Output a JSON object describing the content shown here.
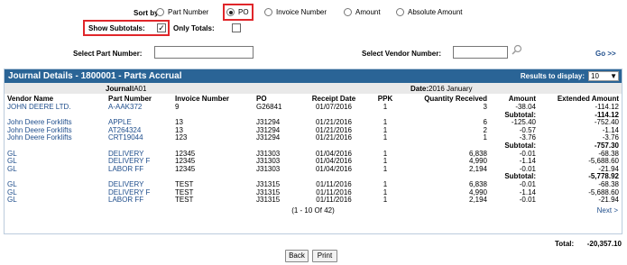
{
  "sort": {
    "label": "Sort by:",
    "options": [
      "Part Number",
      "PO",
      "Invoice Number",
      "Amount",
      "Absolute Amount"
    ],
    "selected": "PO"
  },
  "subtotals": {
    "label": "Show Subtotals:",
    "checked": true,
    "mark": "✓"
  },
  "totals": {
    "label": "Only Totals:",
    "checked": false
  },
  "part_search": {
    "label": "Select Part Number:",
    "value": ""
  },
  "vendor_search": {
    "label": "Select Vendor Number:",
    "value": "",
    "go": "Go >>"
  },
  "panel": {
    "title": "Journal Details - 1800001 - Parts Accrual",
    "results_label": "Results to display:",
    "results_value": "10",
    "journal_label": "Journal:",
    "journal_value": "IA01",
    "date_label": "Date:",
    "date_value": "2016 January"
  },
  "columns": [
    "Vendor Name",
    "Part Number",
    "Invoice Number",
    "PO",
    "Receipt Date",
    "PPK",
    "Quantity Received",
    "Amount",
    "Extended Amount"
  ],
  "rows": [
    {
      "type": "row",
      "cells": [
        "JOHN DEERE LTD.",
        "A-AAK372",
        "9",
        "G26841",
        "01/07/2016",
        "1",
        "3",
        "-38.04",
        "-114.12"
      ]
    },
    {
      "type": "subtotal",
      "label": "Subtotal:",
      "value": "-114.12"
    },
    {
      "type": "row",
      "cells": [
        "John Deere Forklifts",
        "APPLE",
        "13",
        "J31294",
        "01/21/2016",
        "1",
        "6",
        "-125.40",
        "-752.40"
      ]
    },
    {
      "type": "row",
      "cells": [
        "John Deere Forklifts",
        "AT264324",
        "13",
        "J31294",
        "01/21/2016",
        "1",
        "2",
        "-0.57",
        "-1.14"
      ]
    },
    {
      "type": "row",
      "cells": [
        "John Deere Forklifts",
        "CRT19044",
        "123",
        "J31294",
        "01/21/2016",
        "1",
        "1",
        "-3.76",
        "-3.76"
      ]
    },
    {
      "type": "subtotal",
      "label": "Subtotal:",
      "value": "-757.30"
    },
    {
      "type": "row",
      "cells": [
        "GL",
        "DELIVERY",
        "12345",
        "J31303",
        "01/04/2016",
        "1",
        "6,838",
        "-0.01",
        "-68.38"
      ]
    },
    {
      "type": "row",
      "cells": [
        "GL",
        "DELIVERY F",
        "12345",
        "J31303",
        "01/04/2016",
        "1",
        "4,990",
        "-1.14",
        "-5,688.60"
      ]
    },
    {
      "type": "row",
      "cells": [
        "GL",
        "LABOR FF",
        "12345",
        "J31303",
        "01/04/2016",
        "1",
        "2,194",
        "-0.01",
        "-21.94"
      ]
    },
    {
      "type": "subtotal",
      "label": "Subtotal:",
      "value": "-5,778.92"
    },
    {
      "type": "row",
      "cells": [
        "GL",
        "DELIVERY",
        "TEST",
        "J31315",
        "01/11/2016",
        "1",
        "6,838",
        "-0.01",
        "-68.38"
      ]
    },
    {
      "type": "row",
      "cells": [
        "GL",
        "DELIVERY F",
        "TEST",
        "J31315",
        "01/11/2016",
        "1",
        "4,990",
        "-1.14",
        "-5,688.60"
      ]
    },
    {
      "type": "row",
      "cells": [
        "GL",
        "LABOR FF",
        "TEST",
        "J31315",
        "01/11/2016",
        "1",
        "2,194",
        "-0.01",
        "-21.94"
      ]
    }
  ],
  "pager": {
    "range": "(1 - 10 Of 42)",
    "next": "Next >"
  },
  "total": {
    "label": "Total:",
    "value": "-20,357.10"
  },
  "buttons": {
    "back": "Back",
    "print": "Print"
  }
}
